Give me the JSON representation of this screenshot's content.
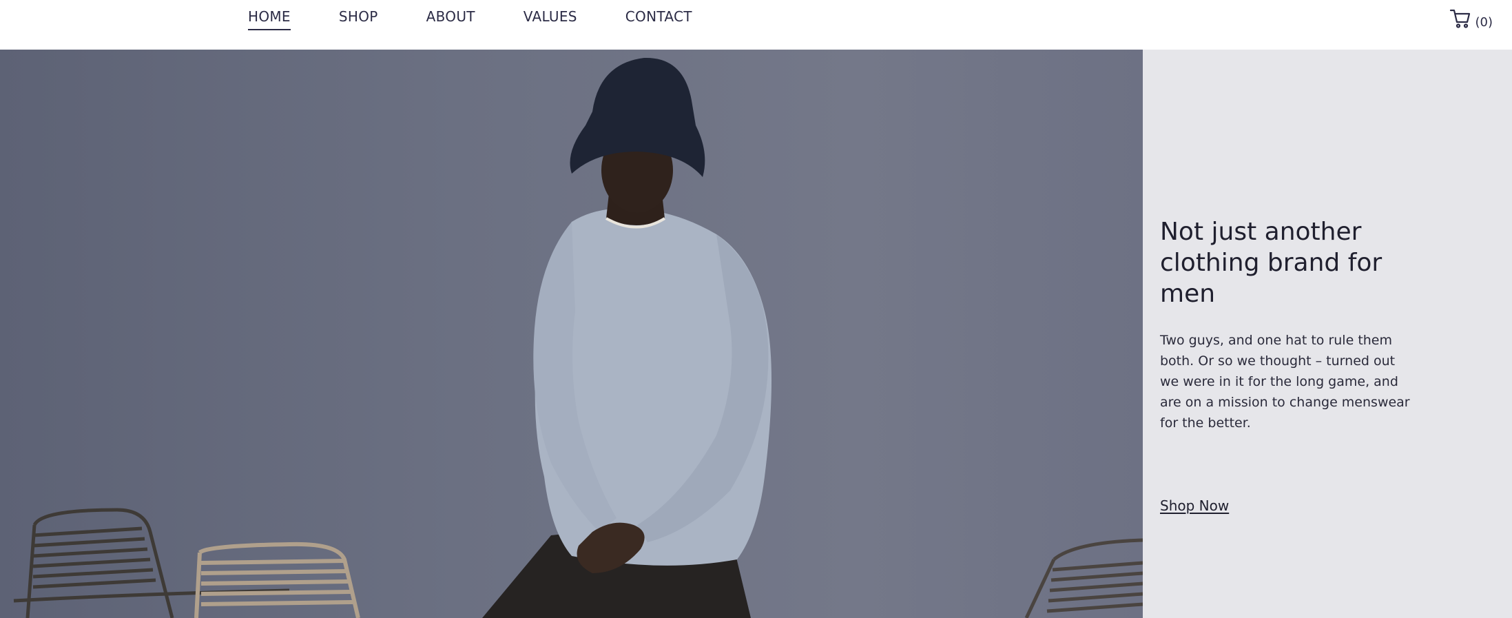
{
  "nav": {
    "items": [
      {
        "label": "HOME",
        "active": true
      },
      {
        "label": "SHOP",
        "active": false
      },
      {
        "label": "ABOUT",
        "active": false
      },
      {
        "label": "VALUES",
        "active": false
      },
      {
        "label": "CONTACT",
        "active": false
      }
    ]
  },
  "cart": {
    "icon": "shopping-cart-icon",
    "count_label": "(0)"
  },
  "hero": {
    "image_alt": "Model in bucket hat and light blue sweatshirt",
    "title": "Not just another clothing brand for men",
    "text": "Two guys, and one hat to rule them both. Or so we thought – turned out we were in it for the long game, and are on a mission to change menswear for the better.",
    "cta_label": "Shop Now"
  },
  "colors": {
    "panel_bg": "#e6e6ea",
    "image_bg": "#6b7082",
    "text_dark": "#1f1f2e"
  }
}
